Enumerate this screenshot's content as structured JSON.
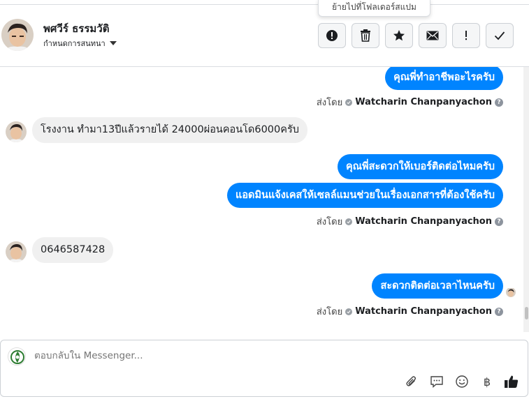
{
  "tooltip": "ย้ายไปที่โฟลเดอร์สแปม",
  "header": {
    "contact_name": "พศวีร์ ธรรมวัติ",
    "conversation_settings": "กำหนดการสนทนา",
    "actions": [
      {
        "icon": "alert-circle-icon",
        "label": "Mark as spam"
      },
      {
        "icon": "trash-icon",
        "label": "Delete"
      },
      {
        "icon": "star-icon",
        "label": "Star"
      },
      {
        "icon": "envelope-icon",
        "label": "Mark unread"
      },
      {
        "icon": "exclamation-icon",
        "label": "Follow up"
      },
      {
        "icon": "checkmark-icon",
        "label": "Done"
      }
    ]
  },
  "messages": [
    {
      "direction": "out",
      "text": "คุณพี่ทำอาชีพอะไรครับ"
    },
    {
      "direction": "meta",
      "sent_by_label": "ส่งโดย",
      "sender": "Watcharin Chanpanyachon",
      "info": "?"
    },
    {
      "direction": "in",
      "text": "โรงงาน ทำมา13ปีแล้วรายได้ 24000ผ่อนคอนโด6000ครับ"
    },
    {
      "direction": "out",
      "text": "คุณพี่สะดวกให้เบอร์ติดต่อไหมครับ"
    },
    {
      "direction": "out",
      "text": "แอดมินแจ้งเคสให้เซลล์แมนช่วยในเรื่องเอกสารที่ต้องใช้ครับ"
    },
    {
      "direction": "meta",
      "sent_by_label": "ส่งโดย",
      "sender": "Watcharin Chanpanyachon",
      "info": "?"
    },
    {
      "direction": "in",
      "text": "0646587428"
    },
    {
      "direction": "out",
      "text": "สะดวกติดต่อเวลาไหนครับ"
    },
    {
      "direction": "meta",
      "sent_by_label": "ส่งโดย",
      "sender": "Watcharin Chanpanyachon",
      "info": "?"
    }
  ],
  "composer": {
    "placeholder": "ตอบกลับใน Messenger...",
    "tools": [
      "paperclip-icon",
      "chat-bubble-icon",
      "smiley-icon",
      "baht-icon",
      "thumbs-up-icon"
    ],
    "baht_symbol": "฿"
  },
  "colors": {
    "outgoing_bubble": "#0084ff",
    "incoming_bubble": "#f0f0f0",
    "thumb": "#1c1e21"
  }
}
